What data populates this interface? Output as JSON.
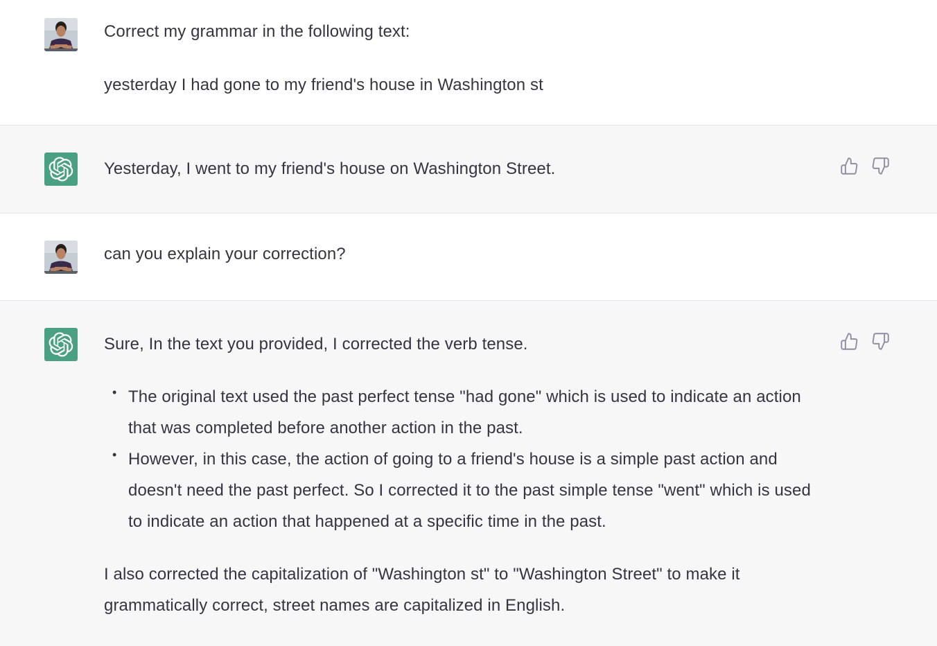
{
  "conversation": {
    "messages": [
      {
        "role": "user",
        "paragraphs": [
          "Correct my grammar in the following text:",
          "yesterday I had gone to my friend's house in Washington st"
        ]
      },
      {
        "role": "assistant",
        "paragraphs": [
          "Yesterday, I went to my friend's house on Washington Street."
        ]
      },
      {
        "role": "user",
        "paragraphs": [
          "can you explain your correction?"
        ]
      },
      {
        "role": "assistant",
        "intro": "Sure, In the text you provided, I corrected the verb tense.",
        "bullets": [
          "The original text used the past perfect tense \"had gone\" which is used to indicate an action that was completed before another action in the past.",
          "However, in this case, the action of going to a friend's house is a simple past action and doesn't need the past perfect. So I corrected it to the past simple tense \"went\" which is used to indicate an action that happened at a specific time in the past."
        ],
        "outro": "I also corrected the capitalization of \"Washington st\" to \"Washington Street\" to make it grammatically correct, street names are capitalized in English."
      }
    ]
  },
  "icons": {
    "user_avatar": "user-avatar-photo",
    "assistant_avatar": "openai-logo-icon",
    "like": "thumbs-up-icon",
    "dislike": "thumbs-down-icon"
  },
  "colors": {
    "assistant_bg": "#f7f7f8",
    "user_bg": "#ffffff",
    "brand_green": "#4aa082",
    "text": "#343541",
    "icon_gray": "#8e8ea0",
    "divider": "#e5e5e9"
  }
}
